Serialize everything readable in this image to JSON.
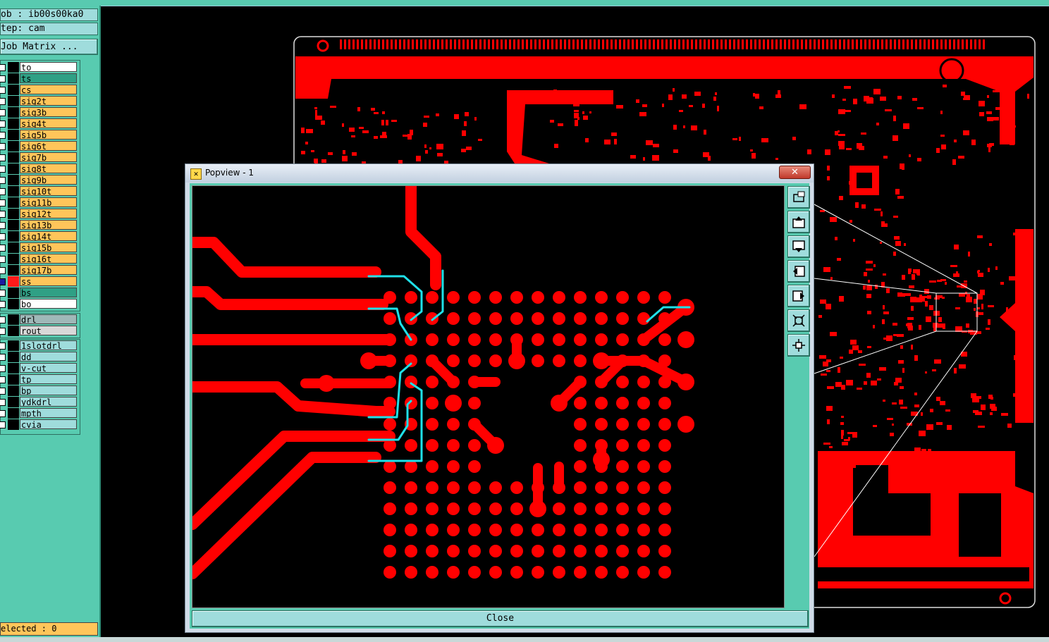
{
  "info": {
    "job": "ob  :  ib00s00ka0",
    "step": "tep:  cam"
  },
  "job_matrix_label": "Job Matrix ...",
  "layers": [
    {
      "name": "to",
      "bg": "#ffffff",
      "swatch": "#000000"
    },
    {
      "name": "ts",
      "bg": "#2fa085",
      "swatch": "#000000"
    },
    {
      "name": "cs",
      "bg": "#ffc55a",
      "swatch": "#000000"
    },
    {
      "name": "sig2t",
      "bg": "#ffc55a",
      "swatch": "#000000"
    },
    {
      "name": "sig3b",
      "bg": "#ffc55a",
      "swatch": "#000000"
    },
    {
      "name": "sig4t",
      "bg": "#ffc55a",
      "swatch": "#000000"
    },
    {
      "name": "sig5b",
      "bg": "#ffc55a",
      "swatch": "#000000"
    },
    {
      "name": "sig6t",
      "bg": "#ffc55a",
      "swatch": "#000000"
    },
    {
      "name": "sig7b",
      "bg": "#ffc55a",
      "swatch": "#000000"
    },
    {
      "name": "sig8t",
      "bg": "#ffc55a",
      "swatch": "#000000"
    },
    {
      "name": "sig9b",
      "bg": "#ffc55a",
      "swatch": "#000000"
    },
    {
      "name": "sig10t",
      "bg": "#ffc55a",
      "swatch": "#000000"
    },
    {
      "name": "sig11b",
      "bg": "#ffc55a",
      "swatch": "#000000"
    },
    {
      "name": "sig12t",
      "bg": "#ffc55a",
      "swatch": "#000000"
    },
    {
      "name": "sig13b",
      "bg": "#ffc55a",
      "swatch": "#000000"
    },
    {
      "name": "sig14t",
      "bg": "#ffc55a",
      "swatch": "#000000"
    },
    {
      "name": "sig15b",
      "bg": "#ffc55a",
      "swatch": "#000000"
    },
    {
      "name": "sig16t",
      "bg": "#ffc55a",
      "swatch": "#000000"
    },
    {
      "name": "sig17b",
      "bg": "#ffc55a",
      "swatch": "#000000"
    },
    {
      "name": "ss",
      "bg": "#ffc55a",
      "swatch": "#ff1a1a",
      "cbcolor": "#1a1aa0"
    },
    {
      "name": "bs",
      "bg": "#2fa085",
      "swatch": "#000000"
    },
    {
      "name": "bo",
      "bg": "#ffffff",
      "swatch": "#000000"
    }
  ],
  "drill_layers": [
    {
      "name": "drl",
      "bg": "#9fb8b8"
    },
    {
      "name": "rout",
      "bg": "#d8d8d8"
    }
  ],
  "other_layers": [
    {
      "name": "1slotdrl",
      "bg": "#9fdcdc"
    },
    {
      "name": "dd",
      "bg": "#9fdcdc"
    },
    {
      "name": "v-cut",
      "bg": "#9fdcdc"
    },
    {
      "name": "tp",
      "bg": "#9fdcdc"
    },
    {
      "name": "bp",
      "bg": "#9fdcdc"
    },
    {
      "name": "ydkdrl",
      "bg": "#9fdcdc"
    },
    {
      "name": "mpth",
      "bg": "#9fdcdc"
    },
    {
      "name": "cvia",
      "bg": "#9fdcdc"
    }
  ],
  "status": "elected : 0",
  "popup": {
    "title": "Popview - 1",
    "close_label": "Close",
    "tools": [
      "zoom-window-icon",
      "move-up-icon",
      "move-down-icon",
      "move-left-icon",
      "move-right-icon",
      "zoom-out-icon",
      "zoom-in-icon"
    ]
  },
  "colors": {
    "copper": "#ff0000",
    "highlight": "#1fe0e8",
    "panel": "#58cbb0",
    "button": "#9fdcdc"
  }
}
